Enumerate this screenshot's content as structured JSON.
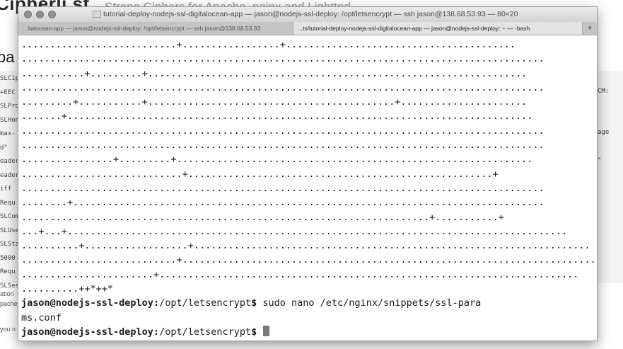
{
  "background_page": {
    "brand": "Cipherli.st",
    "tagline": "Strong Ciphers for Apache, nginx and Lighttpd",
    "heading": "pa",
    "code_fragments": [
      "SLCip",
      "+EEC",
      "SLPro",
      "SLHon",
      "max-",
      "d\"",
      "eader",
      "eader",
      "iff",
      "Requ",
      "SLCom",
      "SLUse",
      "SLSta",
      "5000",
      "Requ",
      "SLSes"
    ],
    "right_fragments": [
      "CM:",
      "age",
      "\""
    ],
    "notes": [
      "ation",
      "pache",
      "you n"
    ]
  },
  "window": {
    "title": "tutorial-deploy-nodejs-ssl-digitalocean-app — jason@nodejs-ssl-deploy: /opt/letsencrypt — ssh jason@138.68.53.93 — 80×20"
  },
  "tabs": [
    {
      "label": "...italocean-app — jason@nodejs-ssl-deploy: /opt/letsencrypt — ssh jason@138.68.53.93",
      "active": true
    },
    {
      "label": "...ts/tutorial-deploy-nodejs-ssl-digitalocean-app — jason@nodejs-ssl-deploy: ~ — -bash",
      "active": false
    }
  ],
  "tab_add_label": "+",
  "terminal": {
    "progress_lines": [
      "...........................+.................+........................................",
      "...........................................................................................",
      "...........+.........+..................................................................",
      "...........................................................................................",
      ".........+...........+...........................................+......................",
      ".......+.................................................................................",
      "...........................................................................................",
      "...........................................................................................",
      "................+.........+..............................................................",
      "............................+.....................................................+",
      "...........................................................................................",
      "........+..................................................................................",
      ".......................................................................+...........+",
      "...+...+.......................................................................................",
      "..........+..................+.....................................................................",
      "...........................+...........................................................................",
      ".......................+.........................................................................",
      "..........++*++*"
    ],
    "command_prompt": "jason@nodejs-ssl-deploy:",
    "command_path": "/opt/letsencrypt",
    "command_sigil": "$",
    "command_text": " sudo nano /etc/nginx/snippets/ssl-para",
    "command_wrap": "ms.conf",
    "current_prompt": "jason@nodejs-ssl-deploy:",
    "current_path": "/opt/letsencrypt",
    "current_sigil": "$"
  }
}
